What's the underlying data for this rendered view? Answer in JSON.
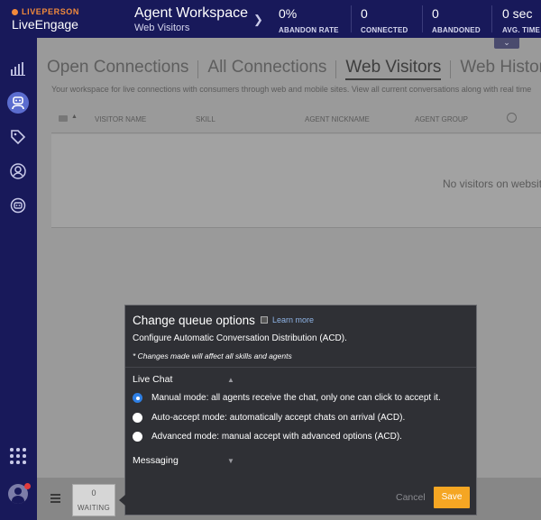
{
  "header": {
    "brand": "LIVEPERSON",
    "product": "LiveEngage",
    "workspace_title": "Agent Workspace",
    "workspace_subtitle": "Web Visitors",
    "metrics": [
      {
        "value": "0%",
        "label": "ABANDON RATE"
      },
      {
        "value": "0",
        "label": "CONNECTED"
      },
      {
        "value": "0",
        "label": "ABANDONED"
      },
      {
        "value": "0 sec",
        "label": "AVG. TIME"
      }
    ]
  },
  "sidebar": {
    "icons": [
      "analytics-icon",
      "agent-icon",
      "tag-icon",
      "user-icon",
      "bot-icon",
      "apps-grid-icon",
      "avatar"
    ]
  },
  "main": {
    "tabs": [
      "Open Connections",
      "All Connections",
      "Web Visitors",
      "Web History"
    ],
    "selected_tab": "Web Visitors",
    "description": "Your workspace for live connections with consumers through web and mobile sites. View all current conversations along with real time",
    "columns": [
      "VISITOR NAME",
      "SKILL",
      "AGENT NICKNAME",
      "AGENT GROUP"
    ],
    "empty_message": "No visitors on website"
  },
  "bottom": {
    "waiting_count": "0",
    "waiting_label": "WAITING"
  },
  "popup": {
    "title": "Change queue options",
    "learn_more": "Learn more",
    "subtitle": "Configure Automatic Conversation Distribution (ACD).",
    "note": "* Changes made will affect all skills and agents",
    "section_live_chat": "Live Chat",
    "options": [
      {
        "label": "Manual mode: all agents receive the chat, only one can click to accept it.",
        "selected": true
      },
      {
        "label": "Auto-accept mode: automatically accept chats on arrival (ACD).",
        "selected": false
      },
      {
        "label": "Advanced mode: manual accept with advanced options (ACD).",
        "selected": false
      }
    ],
    "section_messaging": "Messaging",
    "cancel_label": "Cancel",
    "save_label": "Save"
  },
  "colors": {
    "nav": "#18195a",
    "accent": "#f28a3b",
    "save": "#f5a623",
    "radio_selected": "#2e7fe4"
  }
}
